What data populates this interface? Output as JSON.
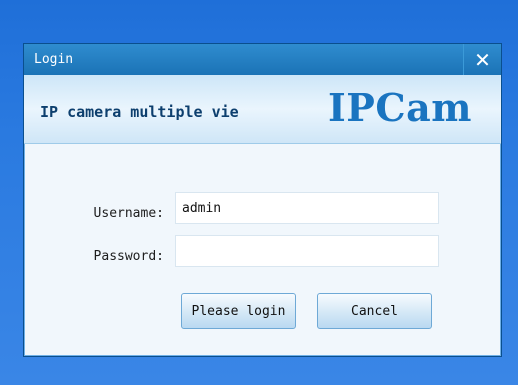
{
  "window": {
    "title": "Login",
    "close_glyph": "✕"
  },
  "banner": {
    "subtitle": "IP camera multiple vie",
    "logo": "IPCam"
  },
  "form": {
    "username_label": "Username:",
    "username_value": "admin",
    "password_label": "Password:",
    "password_value": ""
  },
  "buttons": {
    "login": "Please login",
    "cancel": "Cancel"
  },
  "colors": {
    "desktop": "#2a7ae0",
    "titlebar": "#1b73b6",
    "logo": "#1a74c0"
  }
}
